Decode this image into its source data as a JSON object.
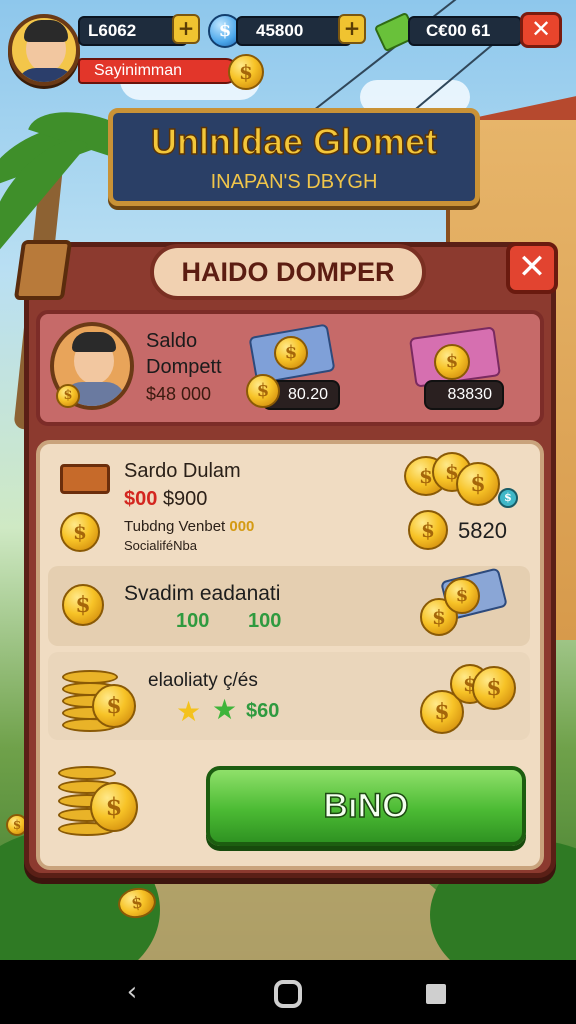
{
  "hud": {
    "counter_1": "L6062",
    "counter_2": "45800",
    "counter_3": "C€00  61",
    "plus_symbol": "+",
    "player_name": "Sayinimman",
    "close_symbol": "✕"
  },
  "banner": {
    "title": "Unlnldae Glomet",
    "subtitle": "INAPAN'S DBYGH"
  },
  "panel": {
    "header": "HAIDO DOMPER",
    "close_symbol": "✕",
    "profile": {
      "name_line1": "Saldo",
      "name_line2": "Dompett",
      "balance": "$48 000",
      "pill_1": "80.20",
      "pill_2": "83830"
    },
    "rows": {
      "row1": {
        "title": "Sardo Dulam",
        "price_red": "$00",
        "price_dark": "$900",
        "desc_text": "Tubdng Venbet",
        "desc_highlight": "000",
        "sub": "SocialiféNba",
        "amount": "5820"
      },
      "row2": {
        "title": "Svadim eadanati",
        "value_1": "100",
        "value_2": "100"
      },
      "row3": {
        "title": "elaoliaty ç/és",
        "value": "$60"
      }
    },
    "cta_label": "BıNO"
  },
  "colors": {
    "panel": "#8c3a2f",
    "cta_green": "#4cbb34",
    "gold": "#f3c73a",
    "banner_blue": "#2a3f66"
  },
  "icons": [
    "avatar",
    "coin-icon",
    "plus-icon",
    "gem-icon",
    "close-icon",
    "brick-icon",
    "star-icon",
    "cash-icon",
    "back-icon",
    "home-icon",
    "recent-icon"
  ]
}
